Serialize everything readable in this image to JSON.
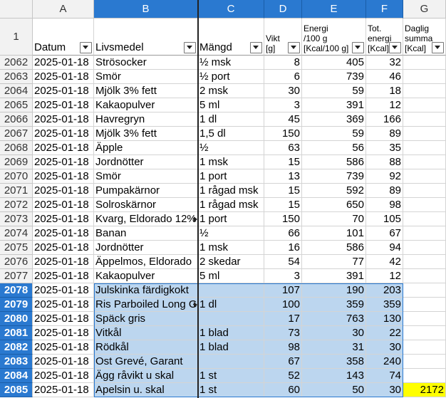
{
  "columns": [
    "A",
    "B",
    "C",
    "D",
    "E",
    "F",
    "G"
  ],
  "header_row": {
    "row_label": "1",
    "labels": [
      "Datum",
      "Livsmedel",
      "Mängd",
      "Vikt\n[g]",
      "Energi\n/100 g\n[Kcal/100 g]",
      "Tot.\nenergi\n[Kcal]",
      "Daglig\nsumma\n[Kcal]"
    ]
  },
  "rows": [
    {
      "row": "2062",
      "date": "2025-01-18",
      "food": "Strösocker",
      "amount": "½ msk",
      "weight": "8",
      "energy100": "405",
      "total": "32",
      "daily": "",
      "selected": false
    },
    {
      "row": "2063",
      "date": "2025-01-18",
      "food": "Smör",
      "amount": "½ port",
      "weight": "6",
      "energy100": "739",
      "total": "46",
      "daily": "",
      "selected": false
    },
    {
      "row": "2064",
      "date": "2025-01-18",
      "food": "Mjölk 3% fett",
      "amount": "2 msk",
      "weight": "30",
      "energy100": "59",
      "total": "18",
      "daily": "",
      "selected": false
    },
    {
      "row": "2065",
      "date": "2025-01-18",
      "food": "Kakaopulver",
      "amount": "5 ml",
      "weight": "3",
      "energy100": "391",
      "total": "12",
      "daily": "",
      "selected": false
    },
    {
      "row": "2066",
      "date": "2025-01-18",
      "food": "Havregryn",
      "amount": "1 dl",
      "weight": "45",
      "energy100": "369",
      "total": "166",
      "daily": "",
      "selected": false
    },
    {
      "row": "2067",
      "date": "2025-01-18",
      "food": "Mjölk 3% fett",
      "amount": "1,5 dl",
      "weight": "150",
      "energy100": "59",
      "total": "89",
      "daily": "",
      "selected": false
    },
    {
      "row": "2068",
      "date": "2025-01-18",
      "food": "Äpple",
      "amount": "½",
      "weight": "63",
      "energy100": "56",
      "total": "35",
      "daily": "",
      "selected": false
    },
    {
      "row": "2069",
      "date": "2025-01-18",
      "food": "Jordnötter",
      "amount": "1 msk",
      "weight": "15",
      "energy100": "586",
      "total": "88",
      "daily": "",
      "selected": false
    },
    {
      "row": "2070",
      "date": "2025-01-18",
      "food": "Smör",
      "amount": "1 port",
      "weight": "13",
      "energy100": "739",
      "total": "92",
      "daily": "",
      "selected": false
    },
    {
      "row": "2071",
      "date": "2025-01-18",
      "food": "Pumpakärnor",
      "amount": "1 rågad msk",
      "weight": "15",
      "energy100": "592",
      "total": "89",
      "daily": "",
      "selected": false
    },
    {
      "row": "2072",
      "date": "2025-01-18",
      "food": "Solroskärnor",
      "amount": "1 rågad msk",
      "weight": "15",
      "energy100": "650",
      "total": "98",
      "daily": "",
      "selected": false
    },
    {
      "row": "2073",
      "date": "2025-01-18",
      "food": "Kvarg, Eldorado 12%",
      "amount": "1 port",
      "weight": "150",
      "energy100": "70",
      "total": "105",
      "daily": "",
      "selected": false,
      "food_truncated": true
    },
    {
      "row": "2074",
      "date": "2025-01-18",
      "food": "Banan",
      "amount": "½",
      "weight": "66",
      "energy100": "101",
      "total": "67",
      "daily": "",
      "selected": false
    },
    {
      "row": "2075",
      "date": "2025-01-18",
      "food": "Jordnötter",
      "amount": "1 msk",
      "weight": "16",
      "energy100": "586",
      "total": "94",
      "daily": "",
      "selected": false
    },
    {
      "row": "2076",
      "date": "2025-01-18",
      "food": "Äppelmos, Eldorado",
      "amount": "2 skedar",
      "weight": "54",
      "energy100": "77",
      "total": "42",
      "daily": "",
      "selected": false
    },
    {
      "row": "2077",
      "date": "2025-01-18",
      "food": "Kakaopulver",
      "amount": "5 ml",
      "weight": "3",
      "energy100": "391",
      "total": "12",
      "daily": "",
      "selected": false
    },
    {
      "row": "2078",
      "date": "2025-01-18",
      "food": "Julskinka färdigkokt",
      "amount": "",
      "weight": "107",
      "energy100": "190",
      "total": "203",
      "daily": "",
      "selected": true
    },
    {
      "row": "2079",
      "date": "2025-01-18",
      "food": "Ris Parboiled Long Grain",
      "amount": "1 dl",
      "weight": "100",
      "energy100": "359",
      "total": "359",
      "daily": "",
      "selected": true,
      "food_truncated": true
    },
    {
      "row": "2080",
      "date": "2025-01-18",
      "food": "Späck gris",
      "amount": "",
      "weight": "17",
      "energy100": "763",
      "total": "130",
      "daily": "",
      "selected": true
    },
    {
      "row": "2081",
      "date": "2025-01-18",
      "food": "Vitkål",
      "amount": "1 blad",
      "weight": "73",
      "energy100": "30",
      "total": "22",
      "daily": "",
      "selected": true
    },
    {
      "row": "2082",
      "date": "2025-01-18",
      "food": "Rödkål",
      "amount": "1 blad",
      "weight": "98",
      "energy100": "31",
      "total": "30",
      "daily": "",
      "selected": true
    },
    {
      "row": "2083",
      "date": "2025-01-18",
      "food": "Ost Grevé, Garant",
      "amount": "",
      "weight": "67",
      "energy100": "358",
      "total": "240",
      "daily": "",
      "selected": true
    },
    {
      "row": "2084",
      "date": "2025-01-18",
      "food": "Ägg råvikt u skal",
      "amount": "1 st",
      "weight": "52",
      "energy100": "143",
      "total": "74",
      "daily": "",
      "selected": true
    },
    {
      "row": "2085",
      "date": "2025-01-18",
      "food": "Apelsin u. skal",
      "amount": "1 st",
      "weight": "60",
      "energy100": "50",
      "total": "30",
      "daily": "2172",
      "selected": true
    }
  ],
  "colors": {
    "selection_fill": "#bcd6ef",
    "header_selected": "#2a79d0",
    "highlight_sum": "#ffff00"
  }
}
